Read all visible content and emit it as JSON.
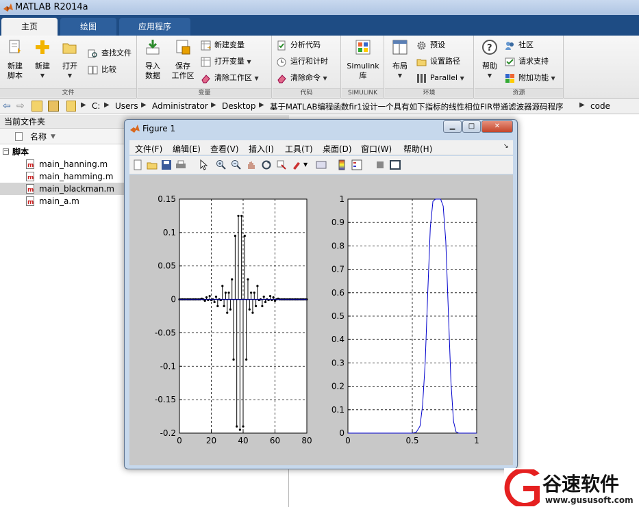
{
  "app": {
    "title": "MATLAB R2014a"
  },
  "tabs": [
    "主页",
    "绘图",
    "应用程序"
  ],
  "ribbon": {
    "new_script": "新建\n脚本",
    "new": "新建",
    "open": "打开",
    "find_files": "查找文件",
    "compare": "比较",
    "group_file": "文件",
    "import_data": "导入\n数据",
    "save_workspace": "保存\n工作区",
    "new_variable": "新建变量",
    "open_variable": "打开变量",
    "clear_workspace": "清除工作区",
    "group_variable": "变量",
    "analyze_code": "分析代码",
    "run_and_time": "运行和计时",
    "clear_commands": "清除命令",
    "group_code": "代码",
    "simulink": "Simulink\n库",
    "group_simulink": "SIMULINK",
    "layout": "布局",
    "preferences": "预设",
    "set_path": "设置路径",
    "parallel": "Parallel",
    "group_environment": "环境",
    "help": "帮助",
    "community": "社区",
    "request_support": "请求支持",
    "add_ons": "附加功能",
    "group_resources": "资源"
  },
  "path": [
    "C:",
    "Users",
    "Administrator",
    "Desktop",
    "基于MATLAB编程函数fir1设计一个具有如下指标的线性相位FIR带通滤波器源码程序",
    "code"
  ],
  "current_folder": {
    "title": "当前文件夹",
    "column_name": "名称",
    "group": "脚本",
    "files": [
      "main_hanning.m",
      "main_hamming.m",
      "main_blackman.m",
      "main_a.m"
    ],
    "selected_index": 2
  },
  "figure": {
    "title": "Figure 1",
    "menu": [
      "文件(F)",
      "编辑(E)",
      "查看(V)",
      "插入(I)",
      "工具(T)",
      "桌面(D)",
      "窗口(W)",
      "帮助(H)"
    ]
  },
  "chart_data": [
    {
      "type": "stem",
      "x": [
        0,
        1,
        2,
        3,
        4,
        5,
        6,
        7,
        8,
        9,
        10,
        11,
        12,
        13,
        14,
        15,
        16,
        17,
        18,
        19,
        20,
        21,
        22,
        23,
        24,
        25,
        26,
        27,
        28,
        29,
        30,
        31,
        32,
        33,
        34,
        35,
        36,
        37,
        38,
        39,
        40,
        41,
        42,
        43,
        44,
        45,
        46,
        47,
        48,
        49,
        50,
        51,
        52,
        53,
        54,
        55,
        56,
        57,
        58,
        59,
        60,
        61,
        62,
        63,
        64,
        65,
        66,
        67,
        68,
        69,
        70,
        71,
        72,
        73,
        74,
        75,
        76,
        77,
        78,
        79,
        80
      ],
      "values": [
        0,
        0,
        0,
        0,
        0,
        0,
        0,
        0,
        0,
        0,
        0,
        0,
        0,
        0,
        0.001,
        0,
        -0.002,
        0.003,
        -0.001,
        0.005,
        -0.001,
        0,
        -0.004,
        0.004,
        -0.01,
        0,
        -0.001,
        0.02,
        -0.01,
        0.01,
        -0.02,
        0.01,
        -0.015,
        0.03,
        -0.09,
        0.095,
        -0.19,
        0.125,
        -0.195,
        0.125,
        -0.19,
        0.095,
        -0.09,
        0.03,
        -0.015,
        0.01,
        -0.02,
        0.01,
        -0.01,
        0.02,
        -0.001,
        0,
        -0.01,
        0.004,
        -0.004,
        0,
        -0.001,
        0.005,
        -0.001,
        0.003,
        -0.002,
        0,
        0.001,
        0,
        0,
        0,
        0,
        0,
        0,
        0,
        0,
        0,
        0,
        0,
        0,
        0,
        0,
        0,
        0,
        0,
        0
      ],
      "xlim": [
        0,
        80
      ],
      "ylim": [
        -0.2,
        0.15
      ],
      "xticks": [
        "0",
        "20",
        "40",
        "60",
        "80"
      ],
      "yticks": [
        "-0.2",
        "-0.15",
        "-0.1",
        "-0.05",
        "0",
        "0.05",
        "0.1",
        "0.15"
      ],
      "grid": true
    },
    {
      "type": "line",
      "x": [
        0,
        0.05,
        0.1,
        0.15,
        0.2,
        0.25,
        0.3,
        0.35,
        0.4,
        0.45,
        0.5,
        0.53,
        0.56,
        0.58,
        0.6,
        0.62,
        0.64,
        0.66,
        0.68,
        0.7,
        0.72,
        0.74,
        0.76,
        0.78,
        0.8,
        0.82,
        0.84,
        0.86,
        0.88,
        0.9,
        0.95,
        1
      ],
      "values": [
        0,
        0,
        0,
        0,
        0,
        0,
        0,
        0,
        0,
        0,
        0,
        0.003,
        0.03,
        0.12,
        0.3,
        0.6,
        0.88,
        0.99,
        1,
        1,
        1,
        0.97,
        0.82,
        0.52,
        0.22,
        0.05,
        0.005,
        0,
        0,
        0,
        0,
        0
      ],
      "xlim": [
        0,
        1
      ],
      "ylim": [
        0,
        1
      ],
      "xticks": [
        "0",
        "0.5",
        "1"
      ],
      "yticks": [
        "0",
        "0.1",
        "0.2",
        "0.3",
        "0.4",
        "0.5",
        "0.6",
        "0.7",
        "0.8",
        "0.9",
        "1"
      ],
      "grid": true,
      "color": "#0000cc"
    }
  ],
  "watermark": {
    "brand": "谷速软件",
    "url": "www.gususoft.com"
  }
}
